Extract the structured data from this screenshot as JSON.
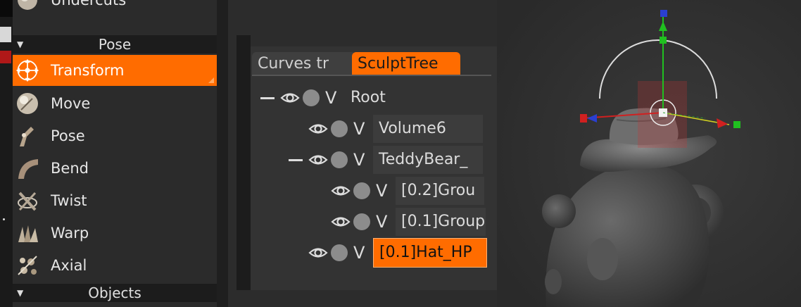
{
  "toolbox": {
    "partial_top_label": "Undercuts",
    "pose_section": "Pose",
    "objects_section": "Objects",
    "tools": [
      {
        "label": "Transform",
        "icon": "transform-icon",
        "active": true
      },
      {
        "label": "Move",
        "icon": "move-icon"
      },
      {
        "label": "Pose",
        "icon": "pose-icon"
      },
      {
        "label": "Bend",
        "icon": "bend-icon"
      },
      {
        "label": "Twist",
        "icon": "twist-icon"
      },
      {
        "label": "Warp",
        "icon": "warp-icon"
      },
      {
        "label": "Axial",
        "icon": "axial-icon"
      }
    ]
  },
  "tree": {
    "tabs": [
      {
        "label": "Curves  tr"
      },
      {
        "label": "SculptTree",
        "active": true
      }
    ],
    "visibility_letter": "V",
    "rows": [
      {
        "name": "Root",
        "collapse": true
      },
      {
        "name": "Volume6"
      },
      {
        "name": "TeddyBear_",
        "collapse": true
      },
      {
        "name": "[0.2]Grou"
      },
      {
        "name": "[0.1]Group"
      },
      {
        "name": "[0.1]Hat_HP",
        "selected": true
      }
    ]
  },
  "colors": {
    "accent": "#ff6c00",
    "panel": "#2b2b2b",
    "viewport": "#303030"
  }
}
